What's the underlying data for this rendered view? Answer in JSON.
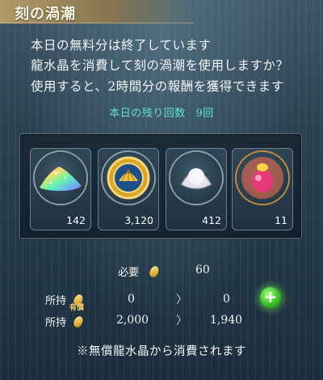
{
  "title": "刻の渦潮",
  "message_lines": [
    "本日の無料分は終了しています",
    "龍水晶を消費して刻の渦潮を使用しますか？",
    "使用すると、2時間分の報酬を獲得できます"
  ],
  "remaining": {
    "label": "本日の残り回数",
    "value": "9回"
  },
  "items": [
    {
      "icon": "rainbow-sand-icon",
      "count": "142"
    },
    {
      "icon": "gold-shell-medal-icon",
      "count": "3,120"
    },
    {
      "icon": "pearl-shell-icon",
      "count": "412"
    },
    {
      "icon": "pink-gem-icon",
      "count": "11"
    }
  ],
  "cost": {
    "label": "必要",
    "value": "60"
  },
  "holdings": {
    "paid": {
      "label": "所持",
      "badge": "有償",
      "before": "0",
      "after": "0"
    },
    "free": {
      "label": "所持",
      "before": "2,000",
      "after": "1,940"
    },
    "arrow": "〉"
  },
  "note": "※無償龍水晶から消費されます",
  "colors": {
    "accent_teal": "#5fe3d8",
    "title_gold": "#b39a6a",
    "plus_green": "#39c02a"
  }
}
